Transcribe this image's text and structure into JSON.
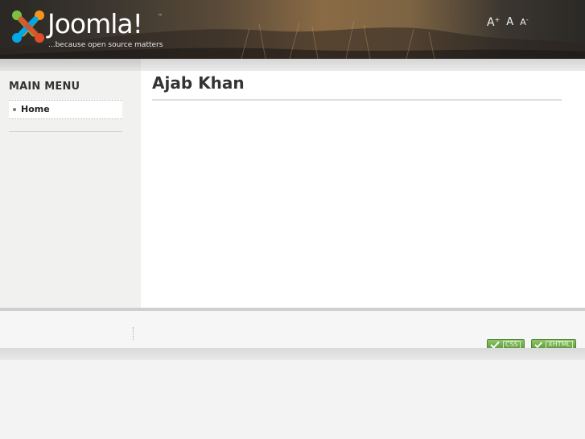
{
  "header": {
    "logo_word": "Joomla!",
    "logo_tm": "™",
    "tagline": "...because open source matters",
    "font_sizer": {
      "increase": "A",
      "increase_sup": "+",
      "reset": "A",
      "decrease": "A",
      "decrease_sup": "-"
    }
  },
  "sidebar": {
    "menu_title": "MAIN MENU",
    "items": [
      {
        "label": "Home"
      }
    ]
  },
  "main": {
    "title": "Ajab Khan"
  },
  "footer": {
    "badges": [
      {
        "label": "CSS"
      },
      {
        "label": "XHTML"
      }
    ]
  },
  "colors": {
    "joomla_red": "#e14d2a",
    "joomla_orange": "#f7941d",
    "joomla_green": "#7ac143",
    "joomla_blue": "#00a8e6",
    "badge_green": "#6aa84f"
  }
}
